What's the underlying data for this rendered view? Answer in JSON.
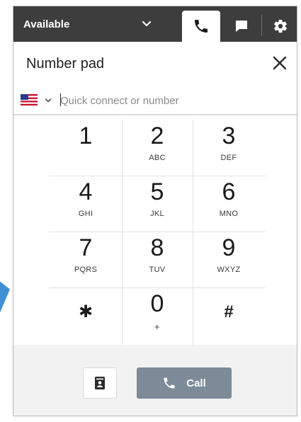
{
  "topbar": {
    "status_label": "Available",
    "status_chevron_icon": "chevron-down-icon",
    "tabs": [
      {
        "icon": "phone-icon",
        "active": true
      },
      {
        "icon": "chat-icon",
        "active": false
      },
      {
        "icon": "gear-icon",
        "active": false
      }
    ]
  },
  "header": {
    "title": "Number pad",
    "close_icon": "close-icon"
  },
  "number_field": {
    "country_flag": "us-flag-icon",
    "placeholder": "Quick connect or number",
    "value": ""
  },
  "keypad": {
    "keys": [
      {
        "digit": "1",
        "letters": ""
      },
      {
        "digit": "2",
        "letters": "ABC"
      },
      {
        "digit": "3",
        "letters": "DEF"
      },
      {
        "digit": "4",
        "letters": "GHI"
      },
      {
        "digit": "5",
        "letters": "JKL"
      },
      {
        "digit": "6",
        "letters": "MNO"
      },
      {
        "digit": "7",
        "letters": "PQRS"
      },
      {
        "digit": "8",
        "letters": "TUV"
      },
      {
        "digit": "9",
        "letters": "WXYZ"
      },
      {
        "digit": "✱",
        "letters": ""
      },
      {
        "digit": "0",
        "letters": "+"
      },
      {
        "digit": "#",
        "letters": ""
      }
    ]
  },
  "footer": {
    "quick_connects_icon": "contact-book-icon",
    "call_label": "Call",
    "call_icon": "phone-icon"
  },
  "colors": {
    "topbar_bg": "#3d3d3d",
    "call_button_bg": "#7d8a97",
    "footer_bg": "#f2f2f2",
    "pointer_accent": "#3f8fd2"
  }
}
